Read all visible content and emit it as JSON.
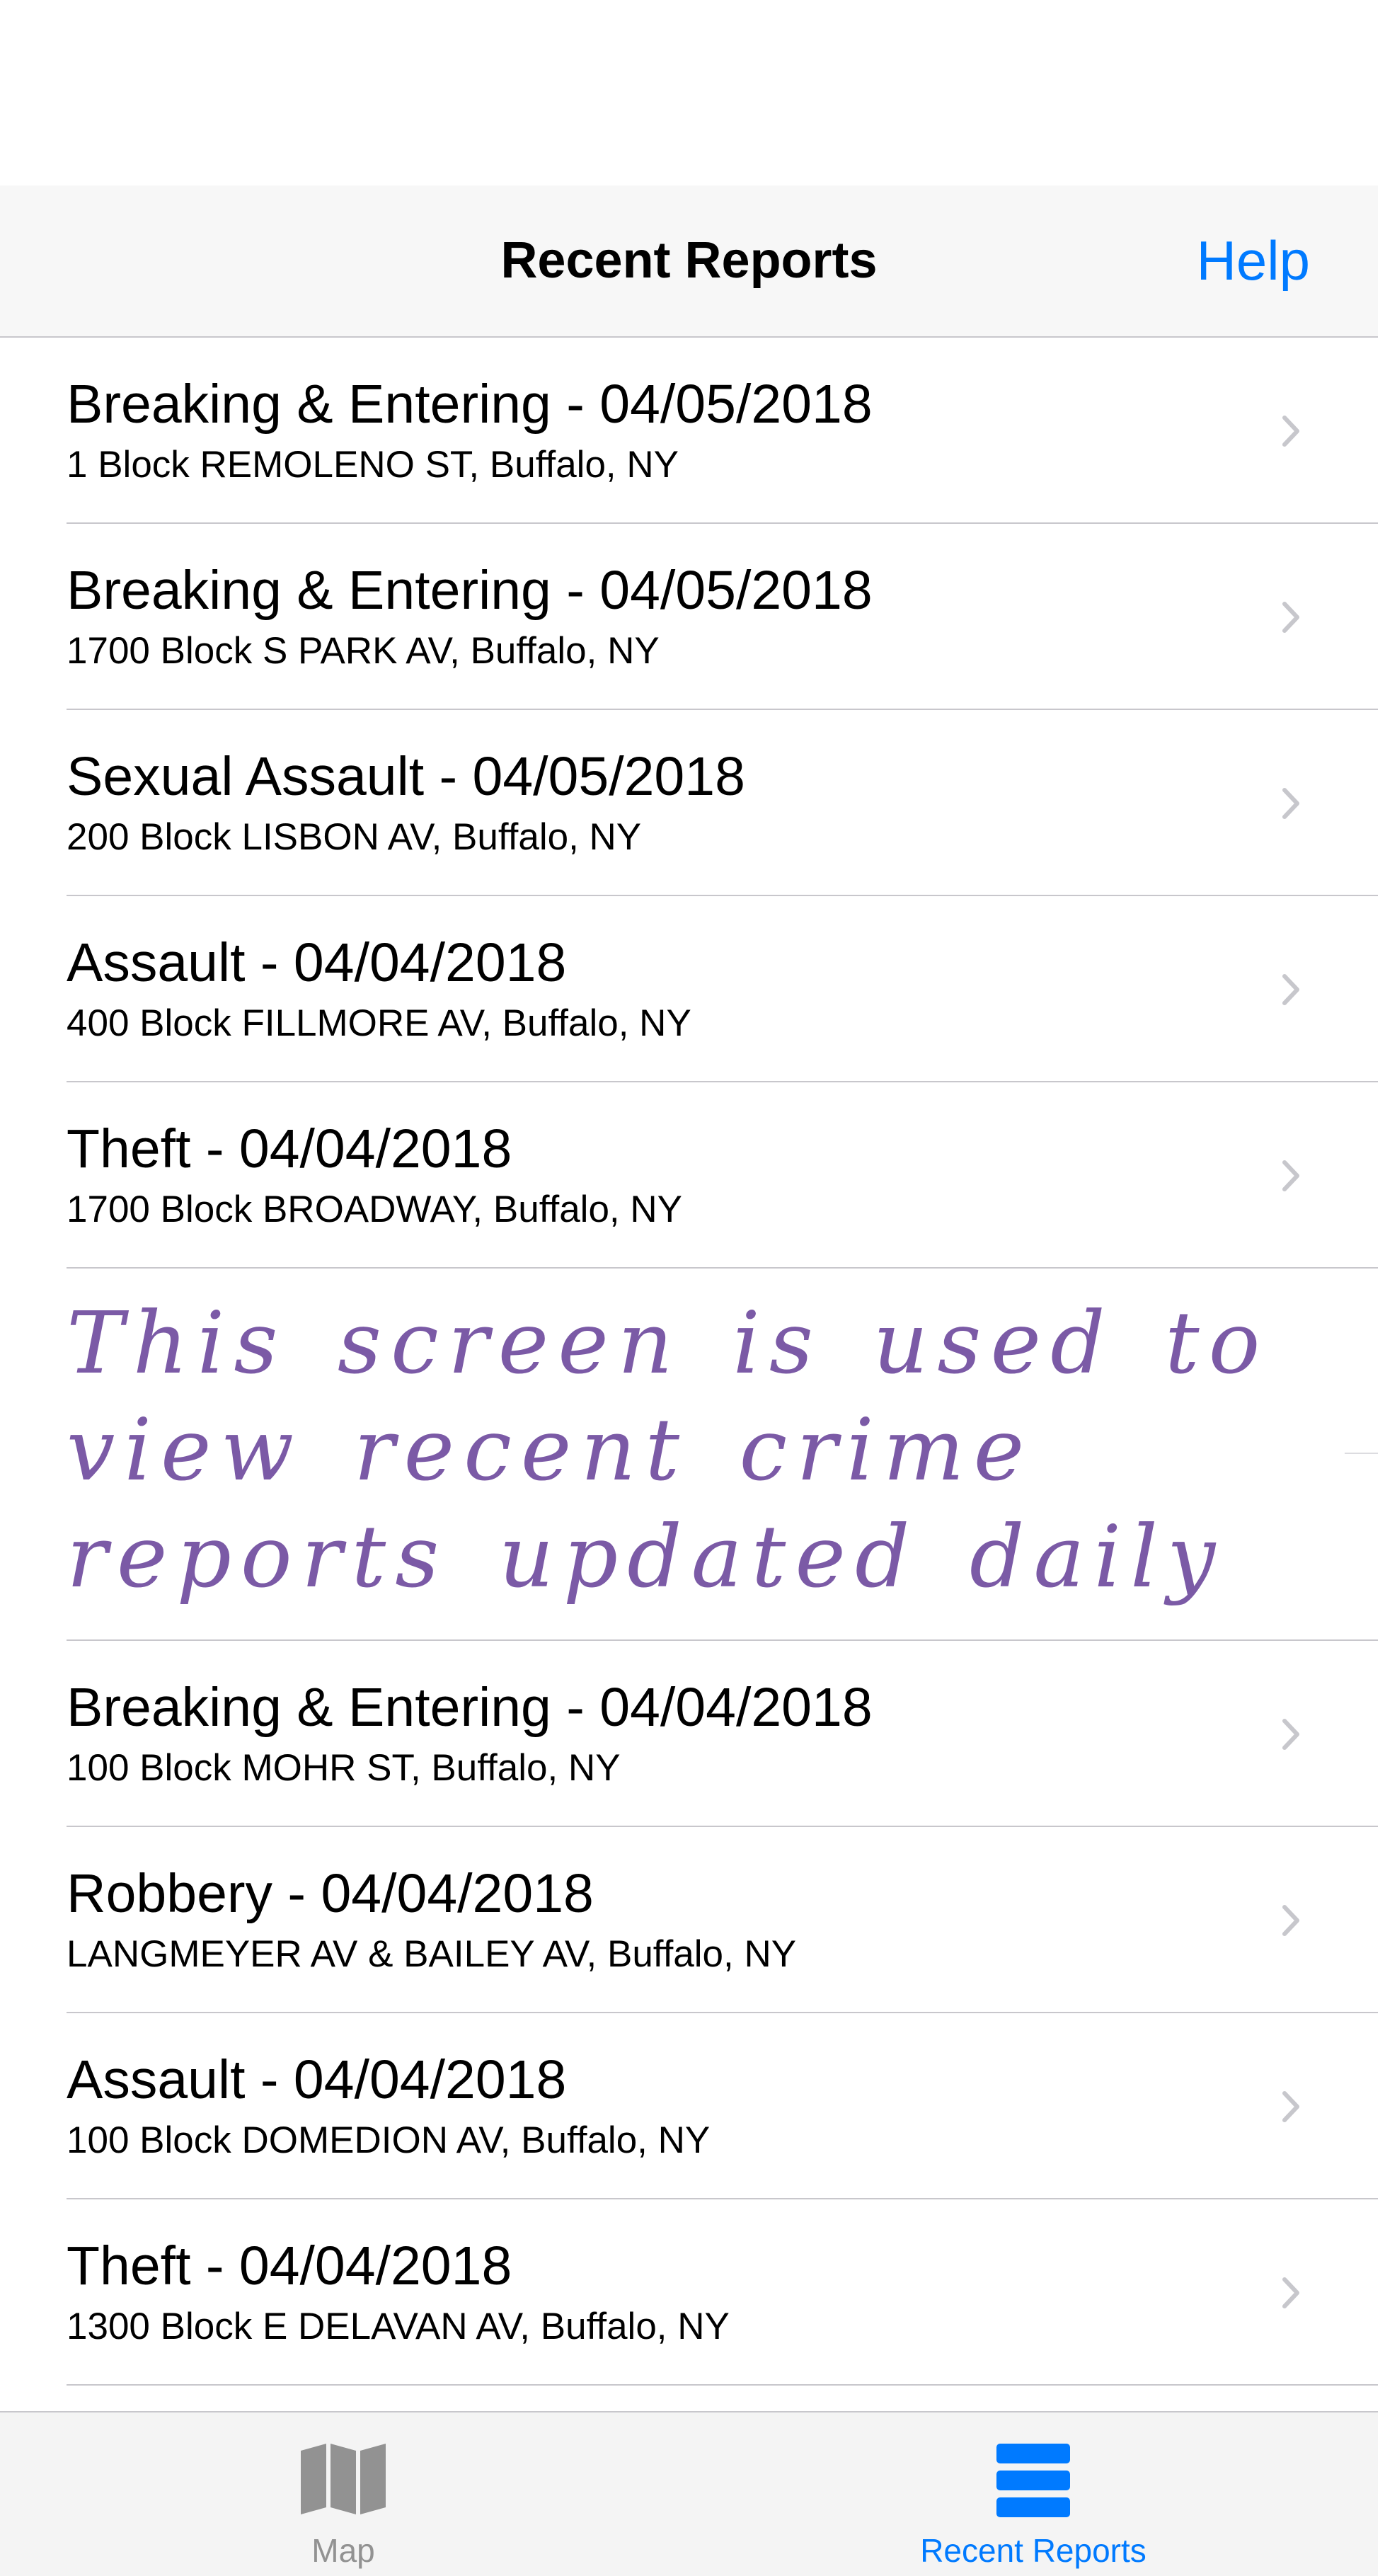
{
  "nav": {
    "title": "Recent Reports",
    "help_label": "Help"
  },
  "reports_before_note": [
    {
      "title": "Breaking & Entering - 04/05/2018",
      "address": "1 Block REMOLENO ST, Buffalo, NY"
    },
    {
      "title": "Breaking & Entering - 04/05/2018",
      "address": "1700 Block S PARK AV, Buffalo, NY"
    },
    {
      "title": "Sexual Assault - 04/05/2018",
      "address": "200 Block LISBON AV, Buffalo, NY"
    },
    {
      "title": "Assault - 04/04/2018",
      "address": "400 Block FILLMORE AV, Buffalo, NY"
    },
    {
      "title": "Theft - 04/04/2018",
      "address": "1700 Block BROADWAY, Buffalo, NY"
    }
  ],
  "annotation": {
    "text": "This screen is used to view recent crime reports updated daily"
  },
  "reports_after_note": [
    {
      "title": "Breaking & Entering - 04/04/2018",
      "address": "100 Block MOHR ST, Buffalo, NY"
    },
    {
      "title": "Robbery - 04/04/2018",
      "address": "LANGMEYER AV & BAILEY AV, Buffalo, NY"
    },
    {
      "title": "Assault - 04/04/2018",
      "address": "100 Block DOMEDION AV, Buffalo, NY"
    },
    {
      "title": "Theft - 04/04/2018",
      "address": "1300 Block E DELAVAN AV, Buffalo, NY"
    }
  ],
  "tabs": [
    {
      "label": "Map",
      "icon": "map-icon",
      "selected": false
    },
    {
      "label": "Recent Reports",
      "icon": "list-icon",
      "selected": true
    }
  ],
  "colors": {
    "accent": "#007aff",
    "inactive_tab": "#929292",
    "annotation": "#7b5aa6",
    "separator": "#c8c7cc",
    "nav_background": "#f7f7f7"
  }
}
